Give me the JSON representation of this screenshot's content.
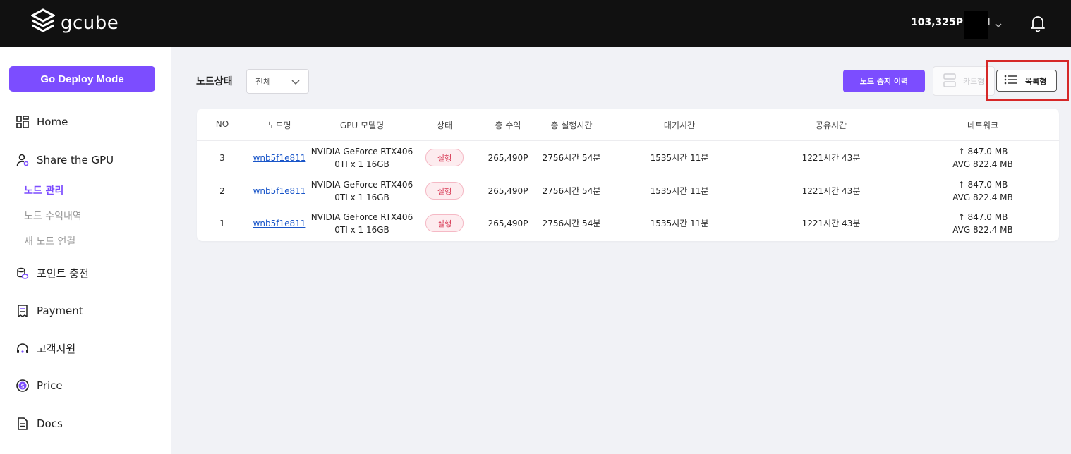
{
  "header": {
    "logo_text": "gcube",
    "points": "103,325P",
    "user_suffix": "l",
    "bell_icon": "bell-icon"
  },
  "sidebar": {
    "deploy_button": "Go Deploy Mode",
    "items": [
      {
        "label": "Home",
        "icon": "home-grid-icon"
      },
      {
        "label": "Share the GPU",
        "icon": "user-share-icon"
      },
      {
        "label": "포인트 충전",
        "icon": "coins-icon"
      },
      {
        "label": "Payment",
        "icon": "receipt-icon"
      },
      {
        "label": "고객지원",
        "icon": "headset-icon"
      },
      {
        "label": "Price",
        "icon": "dollar-circle-icon"
      },
      {
        "label": "Docs",
        "icon": "document-icon"
      }
    ],
    "sub_items": [
      {
        "label": "노드 관리",
        "active": true
      },
      {
        "label": "노드 수익내역",
        "active": false
      },
      {
        "label": "새 노드 연결",
        "active": false
      }
    ]
  },
  "toolbar": {
    "status_label": "노드상태",
    "status_select_value": "전체",
    "history_button": "노드 중지 이력",
    "card_view_button": "카드형",
    "list_view_button": "목록형"
  },
  "table": {
    "headers": [
      "NO",
      "노드명",
      "GPU 모델명",
      "상태",
      "총 수익",
      "총 실행시간",
      "대기시간",
      "공유시간",
      "네트워크"
    ],
    "rows": [
      {
        "no": "3",
        "node": "wnb5f1e811",
        "gpu_line1": "NVIDIA GeForce RTX406",
        "gpu_line2": "0TI x 1 16GB",
        "status": "실행",
        "revenue": "265,490P",
        "run_time": "2756시간 54분",
        "idle_time": "1535시간 11분",
        "share_time": "1221시간 43분",
        "net_line1": "↑ 847.0 MB",
        "net_line2": "AVG 822.4 MB"
      },
      {
        "no": "2",
        "node": "wnb5f1e811",
        "gpu_line1": "NVIDIA GeForce RTX406",
        "gpu_line2": "0TI x 1 16GB",
        "status": "실행",
        "revenue": "265,490P",
        "run_time": "2756시간 54분",
        "idle_time": "1535시간 11분",
        "share_time": "1221시간 43분",
        "net_line1": "↑ 847.0 MB",
        "net_line2": "AVG 822.4 MB"
      },
      {
        "no": "1",
        "node": "wnb5f1e811",
        "gpu_line1": "NVIDIA GeForce RTX406",
        "gpu_line2": "0TI x 1 16GB",
        "status": "실행",
        "revenue": "265,490P",
        "run_time": "2756시간 54분",
        "idle_time": "1535시간 11분",
        "share_time": "1221시간 43분",
        "net_line1": "↑ 847.0 MB",
        "net_line2": "AVG 822.4 MB"
      }
    ]
  },
  "colors": {
    "accent": "#7c4dff",
    "topbar": "#111111",
    "status_badge_text": "#d6334f",
    "highlight": "#d62828"
  }
}
